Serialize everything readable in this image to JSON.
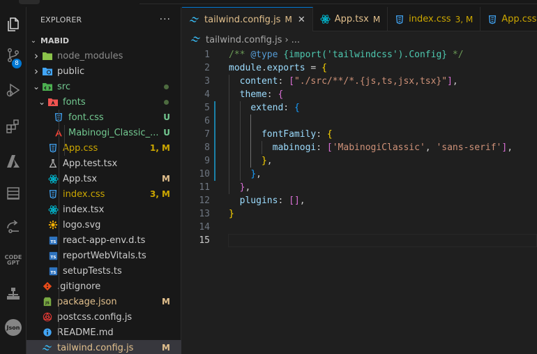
{
  "explorer": {
    "title": "EXPLORER",
    "more_actions": "···",
    "root": "MABID",
    "items": [
      {
        "name": "node_modules",
        "type": "folder",
        "expanded": false,
        "depth": 1,
        "dim": true
      },
      {
        "name": "public",
        "type": "folder",
        "expanded": false,
        "depth": 1
      },
      {
        "name": "src",
        "type": "folder",
        "expanded": true,
        "depth": 1,
        "color": "#73c991",
        "dot": true
      },
      {
        "name": "fonts",
        "type": "folder",
        "expanded": true,
        "depth": 2,
        "color": "#73c991",
        "dot": true
      },
      {
        "name": "font.css",
        "type": "css",
        "depth": 3,
        "color": "#73c991",
        "status": "U"
      },
      {
        "name": "Mabinogi_Classic_...",
        "type": "font",
        "depth": 3,
        "color": "#73c991",
        "status": "U"
      },
      {
        "name": "App.css",
        "type": "css",
        "depth": 2,
        "color": "#cca700",
        "status": "1, M"
      },
      {
        "name": "App.test.tsx",
        "type": "test",
        "depth": 2
      },
      {
        "name": "App.tsx",
        "type": "react",
        "depth": 2,
        "status": "M"
      },
      {
        "name": "index.css",
        "type": "css",
        "depth": 2,
        "color": "#cca700",
        "status": "3, M"
      },
      {
        "name": "index.tsx",
        "type": "react",
        "depth": 2
      },
      {
        "name": "logo.svg",
        "type": "svg",
        "depth": 2
      },
      {
        "name": "react-app-env.d.ts",
        "type": "ts",
        "depth": 2
      },
      {
        "name": "reportWebVitals.ts",
        "type": "ts",
        "depth": 2
      },
      {
        "name": "setupTests.ts",
        "type": "ts",
        "depth": 2
      },
      {
        "name": ".gitignore",
        "type": "git",
        "depth": 1
      },
      {
        "name": "package.json",
        "type": "json",
        "depth": 1,
        "color": "#e2c08d",
        "status": "M"
      },
      {
        "name": "postcss.config.js",
        "type": "postcss",
        "depth": 1
      },
      {
        "name": "README.md",
        "type": "info",
        "depth": 1
      },
      {
        "name": "tailwind.config.js",
        "type": "tailwind",
        "depth": 1,
        "color": "#e2c08d",
        "status": "M",
        "selected": true
      }
    ]
  },
  "activity": {
    "scm_badge": "8",
    "codegpt_label_1": "CODE",
    "codegpt_label_2": "GPT",
    "json_label": "Json"
  },
  "tabs": [
    {
      "label": "tailwind.config.js",
      "status": "M",
      "active": true,
      "icon": "tailwind",
      "close": "✕"
    },
    {
      "label": "App.tsx",
      "status": "M",
      "active": false,
      "icon": "react"
    },
    {
      "label": "index.css",
      "status": "3, M",
      "active": false,
      "icon": "css"
    },
    {
      "label": "App.css",
      "status": "",
      "active": false,
      "icon": "css"
    }
  ],
  "breadcrumb": {
    "file": "tailwind.config.js",
    "sep": "›",
    "rest": "..."
  },
  "editor": {
    "current_line": 15,
    "lines": [
      [
        [
          "/** ",
          "com"
        ],
        [
          "@type",
          "kw"
        ],
        [
          " ",
          "com"
        ],
        [
          "{",
          "type"
        ],
        [
          "import",
          "type"
        ],
        [
          "(",
          "type"
        ],
        [
          "'tailwindcss'",
          "type"
        ],
        [
          ").",
          "type"
        ],
        [
          "Config",
          "type"
        ],
        [
          "}",
          "type"
        ],
        [
          " */",
          "com"
        ]
      ],
      [
        [
          "module",
          "prop"
        ],
        [
          ".",
          "p"
        ],
        [
          "exports",
          "prop"
        ],
        [
          " = ",
          "p"
        ],
        [
          "{",
          "b1"
        ]
      ],
      [
        [
          "  ",
          "p"
        ],
        [
          "content",
          "prop"
        ],
        [
          ": ",
          "p"
        ],
        [
          "[",
          "b2"
        ],
        [
          "\"./src/**/*.{js,ts,jsx,tsx}\"",
          "str"
        ],
        [
          "]",
          "b2"
        ],
        [
          ",",
          "p"
        ]
      ],
      [
        [
          "  ",
          "p"
        ],
        [
          "theme",
          "prop"
        ],
        [
          ": ",
          "p"
        ],
        [
          "{",
          "b2"
        ]
      ],
      [
        [
          "    ",
          "p"
        ],
        [
          "extend",
          "prop"
        ],
        [
          ": ",
          "p"
        ],
        [
          "{",
          "b3"
        ]
      ],
      [],
      [
        [
          "      ",
          "p"
        ],
        [
          "fontFamily",
          "prop"
        ],
        [
          ": ",
          "p"
        ],
        [
          "{",
          "b1"
        ]
      ],
      [
        [
          "        ",
          "p"
        ],
        [
          "mabinogi",
          "prop"
        ],
        [
          ": ",
          "p"
        ],
        [
          "[",
          "b2"
        ],
        [
          "'MabinogiClassic'",
          "str"
        ],
        [
          ", ",
          "p"
        ],
        [
          "'sans-serif'",
          "str"
        ],
        [
          "]",
          "b2"
        ],
        [
          ",",
          "p"
        ]
      ],
      [
        [
          "      ",
          "p"
        ],
        [
          "}",
          "b1"
        ],
        [
          ",",
          "p"
        ]
      ],
      [
        [
          "    ",
          "p"
        ],
        [
          "}",
          "b3"
        ],
        [
          ",",
          "p"
        ]
      ],
      [
        [
          "  ",
          "p"
        ],
        [
          "}",
          "b2"
        ],
        [
          ",",
          "p"
        ]
      ],
      [
        [
          "  ",
          "p"
        ],
        [
          "plugins",
          "prop"
        ],
        [
          ": ",
          "p"
        ],
        [
          "[",
          "b2"
        ],
        [
          "]",
          "b2"
        ],
        [
          ",",
          "p"
        ]
      ],
      [
        [
          "}",
          "b1"
        ]
      ],
      [],
      []
    ]
  },
  "colors": {
    "accent": "#0078d4",
    "untracked": "#73c991",
    "modified": "#e2c08d",
    "warning": "#cca700"
  }
}
